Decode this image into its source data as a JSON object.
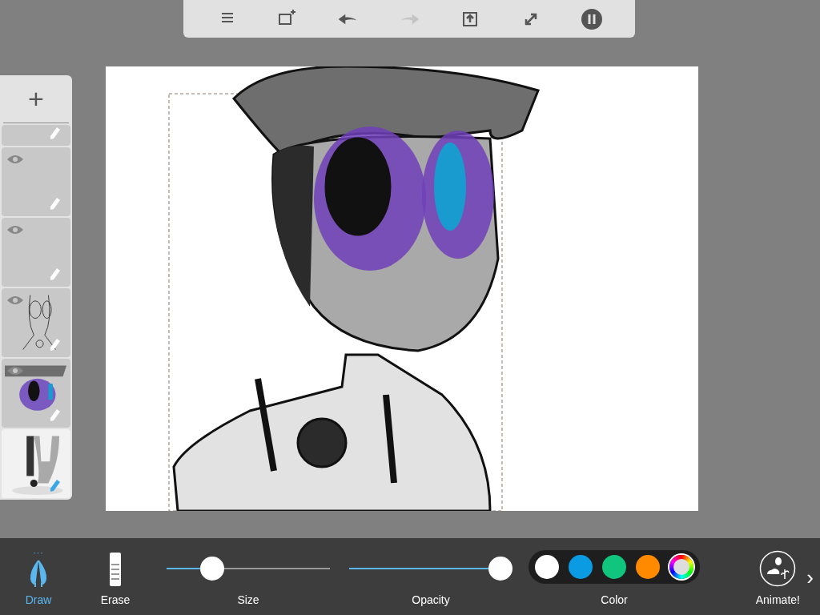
{
  "toolbar": {
    "buttons": [
      {
        "kind": "menu",
        "disabled": false
      },
      {
        "kind": "add-frame",
        "disabled": false
      },
      {
        "kind": "undo",
        "disabled": false
      },
      {
        "kind": "redo",
        "disabled": true
      },
      {
        "kind": "share",
        "disabled": false
      },
      {
        "kind": "expand",
        "disabled": false
      },
      {
        "kind": "pause",
        "disabled": false
      }
    ]
  },
  "layers": {
    "add_label": "+",
    "items": [
      {
        "kind": "partial",
        "visible": false,
        "selected": false
      },
      {
        "kind": "empty",
        "visible": true,
        "selected": false
      },
      {
        "kind": "empty",
        "visible": true,
        "selected": false
      },
      {
        "kind": "lineart",
        "visible": true,
        "selected": false
      },
      {
        "kind": "color",
        "visible": true,
        "selected": false
      },
      {
        "kind": "shading",
        "visible": false,
        "selected": true
      }
    ]
  },
  "tools": [
    {
      "label": "Draw",
      "kind": "draw",
      "selected": true,
      "options_mark": "···"
    },
    {
      "label": "Erase",
      "kind": "erase",
      "selected": false
    }
  ],
  "sliders": [
    {
      "label": "Size",
      "level": 0.24
    },
    {
      "label": "Opacity",
      "level": 1
    }
  ],
  "color": {
    "label": "Color",
    "swatches": [
      {
        "color": "#ffffff",
        "selected": false
      },
      {
        "color": "#0a9be3",
        "selected": false
      },
      {
        "color": "#10c57e",
        "selected": false
      },
      {
        "color": "#ff8a00",
        "selected": false
      },
      {
        "kind": "wheel",
        "selected": true
      }
    ]
  },
  "animate": {
    "label": "Animate!",
    "more": "›"
  }
}
